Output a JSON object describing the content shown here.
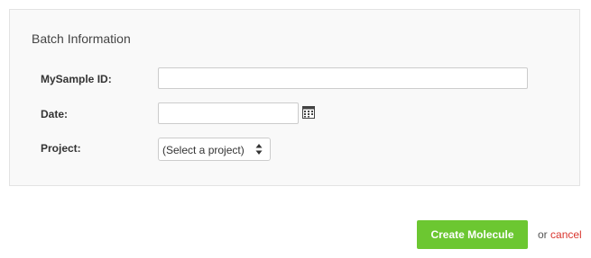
{
  "batch_panel": {
    "title": "Batch Information",
    "fields": [
      {
        "label": "MySample ID:",
        "value": "",
        "placeholder": ""
      },
      {
        "label": "Date:",
        "value": "",
        "placeholder": ""
      },
      {
        "label": "Project:",
        "selected": "(Select a project)"
      }
    ],
    "icons": {
      "calendar": "calendar-icon",
      "select_arrows": "up-down-arrows-icon"
    }
  },
  "actions": {
    "create_label": "Create Molecule",
    "or_text": "or",
    "cancel_label": "cancel"
  },
  "colors": {
    "primary_button": "#6cc731",
    "cancel_link": "#d9352e",
    "panel_background": "#f9f9f9"
  }
}
